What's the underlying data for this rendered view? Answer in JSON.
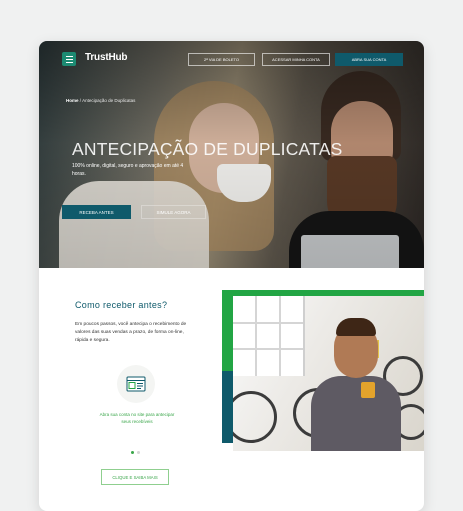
{
  "nav": {
    "logo": "TrustHub",
    "buttons": [
      "2ª VIA DE BOLETO",
      "ACESSAR MINHA CONTA",
      "ABRA SUA CONTA"
    ]
  },
  "breadcrumb": {
    "home": "Home",
    "separator": "/",
    "current": "Antecipação de Duplicatas"
  },
  "hero": {
    "title": "ANTECIPAÇÃO DE DUPLICATAS",
    "subtitle": "100% online, digital, seguro e aprovação em até 4 horas.",
    "primary_button": "RECEBA ANTES",
    "secondary_button": "SIMULE AGORA"
  },
  "section": {
    "title": "Como receber antes?",
    "text": "Em poucos passos, você antecipa o recebimento de valores das suas vendas a prazo, de forma on-line, rápida e segura.",
    "icon": "browser-window-icon",
    "caption": "Abra sua conta no site para antecipar seus recebíveis",
    "button": "CLIQUE E SAIBA MAIS"
  },
  "colors": {
    "accent_green": "#22a544",
    "accent_blue": "#0f5a6b"
  }
}
